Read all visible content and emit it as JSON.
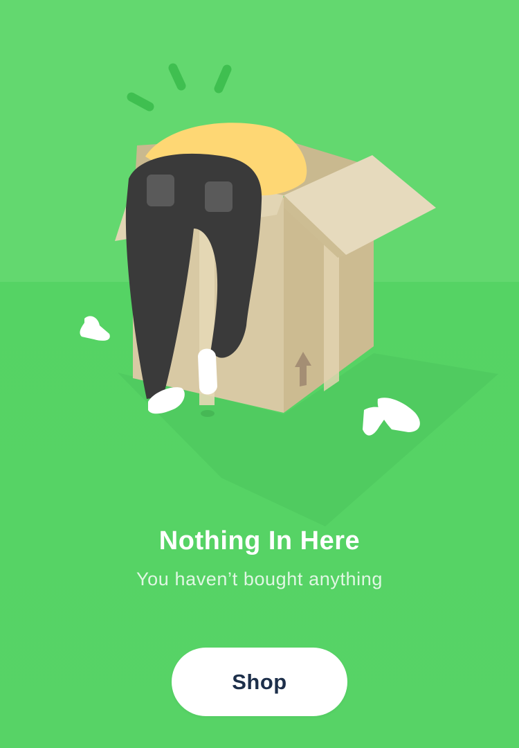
{
  "empty_state": {
    "title": "Nothing In Here",
    "subtitle": "You haven’t bought anything",
    "illustration": "person-searching-inside-cardboard-box"
  },
  "actions": {
    "shop_label": "Shop"
  },
  "colors": {
    "background": "#5ad66a",
    "floor": "#55d364",
    "box": "#dccda9",
    "shirt": "#fed774",
    "pants": "#3a3a3a",
    "button": "#ffffff",
    "button_text": "#1d2f4a"
  }
}
